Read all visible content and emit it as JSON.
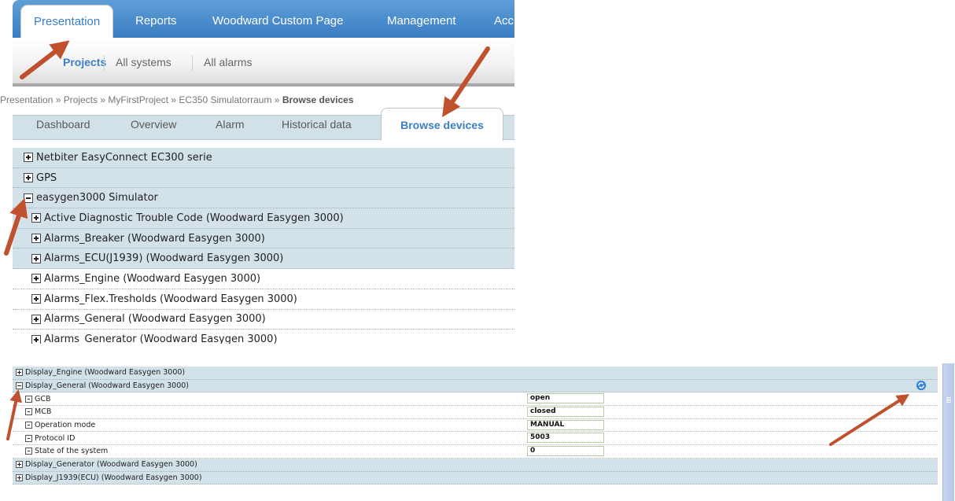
{
  "main_tabs": [
    "Presentation",
    "Reports",
    "Woodward Custom Page",
    "Management",
    "Acc"
  ],
  "sub_nav": [
    "Projects",
    "All systems",
    "All alarms"
  ],
  "breadcrumb": {
    "path": "Presentation » Projects » MyFirstProject » EC350 Simulatorraum » ",
    "current": "Browse devices"
  },
  "device_tabs": [
    "Dashboard",
    "Overview",
    "Alarm",
    "Historical data",
    "Browse devices"
  ],
  "device_tree": [
    {
      "label": "Netbiter EasyConnect EC300 serie",
      "expanded": false
    },
    {
      "label": "GPS",
      "expanded": false
    },
    {
      "label": "easygen3000 Simulator",
      "expanded": true
    },
    {
      "label": "Active Diagnostic Trouble Code (Woodward Easygen 3000)",
      "expanded": false
    },
    {
      "label": "Alarms_Breaker (Woodward Easygen 3000)",
      "expanded": false
    },
    {
      "label": "Alarms_ECU(J1939) (Woodward Easygen 3000)",
      "expanded": false
    },
    {
      "label": "Alarms_Engine (Woodward Easygen 3000)",
      "expanded": false
    },
    {
      "label": "Alarms_Flex.Tresholds (Woodward Easygen 3000)",
      "expanded": false
    },
    {
      "label": "Alarms_General (Woodward Easygen 3000)",
      "expanded": false
    },
    {
      "label": "Alarms_Generator (Woodward Easygen 3000)",
      "expanded": false
    }
  ],
  "detail_tree": [
    {
      "label": "Display_Engine (Woodward Easygen 3000)",
      "expanded": false
    },
    {
      "label": "Display_General (Woodward Easygen 3000)",
      "expanded": true
    },
    {
      "label": "GCB",
      "value": "open"
    },
    {
      "label": "MCB",
      "value": "closed"
    },
    {
      "label": "Operation mode",
      "value": "MANUAL"
    },
    {
      "label": "Protocol ID",
      "value": "5003"
    },
    {
      "label": "State of the system",
      "value": "0"
    },
    {
      "label": "Display_Generator (Woodward Easygen 3000)",
      "expanded": false
    },
    {
      "label": "Display_J1939(ECU) (Woodward Easygen 3000)",
      "expanded": false
    }
  ],
  "icons": {
    "refresh": "refresh-icon",
    "arrow_color": "#c0512f"
  },
  "colors": {
    "tab_blue": "#3b7fc4",
    "row_tint": "#d3e2e8"
  }
}
